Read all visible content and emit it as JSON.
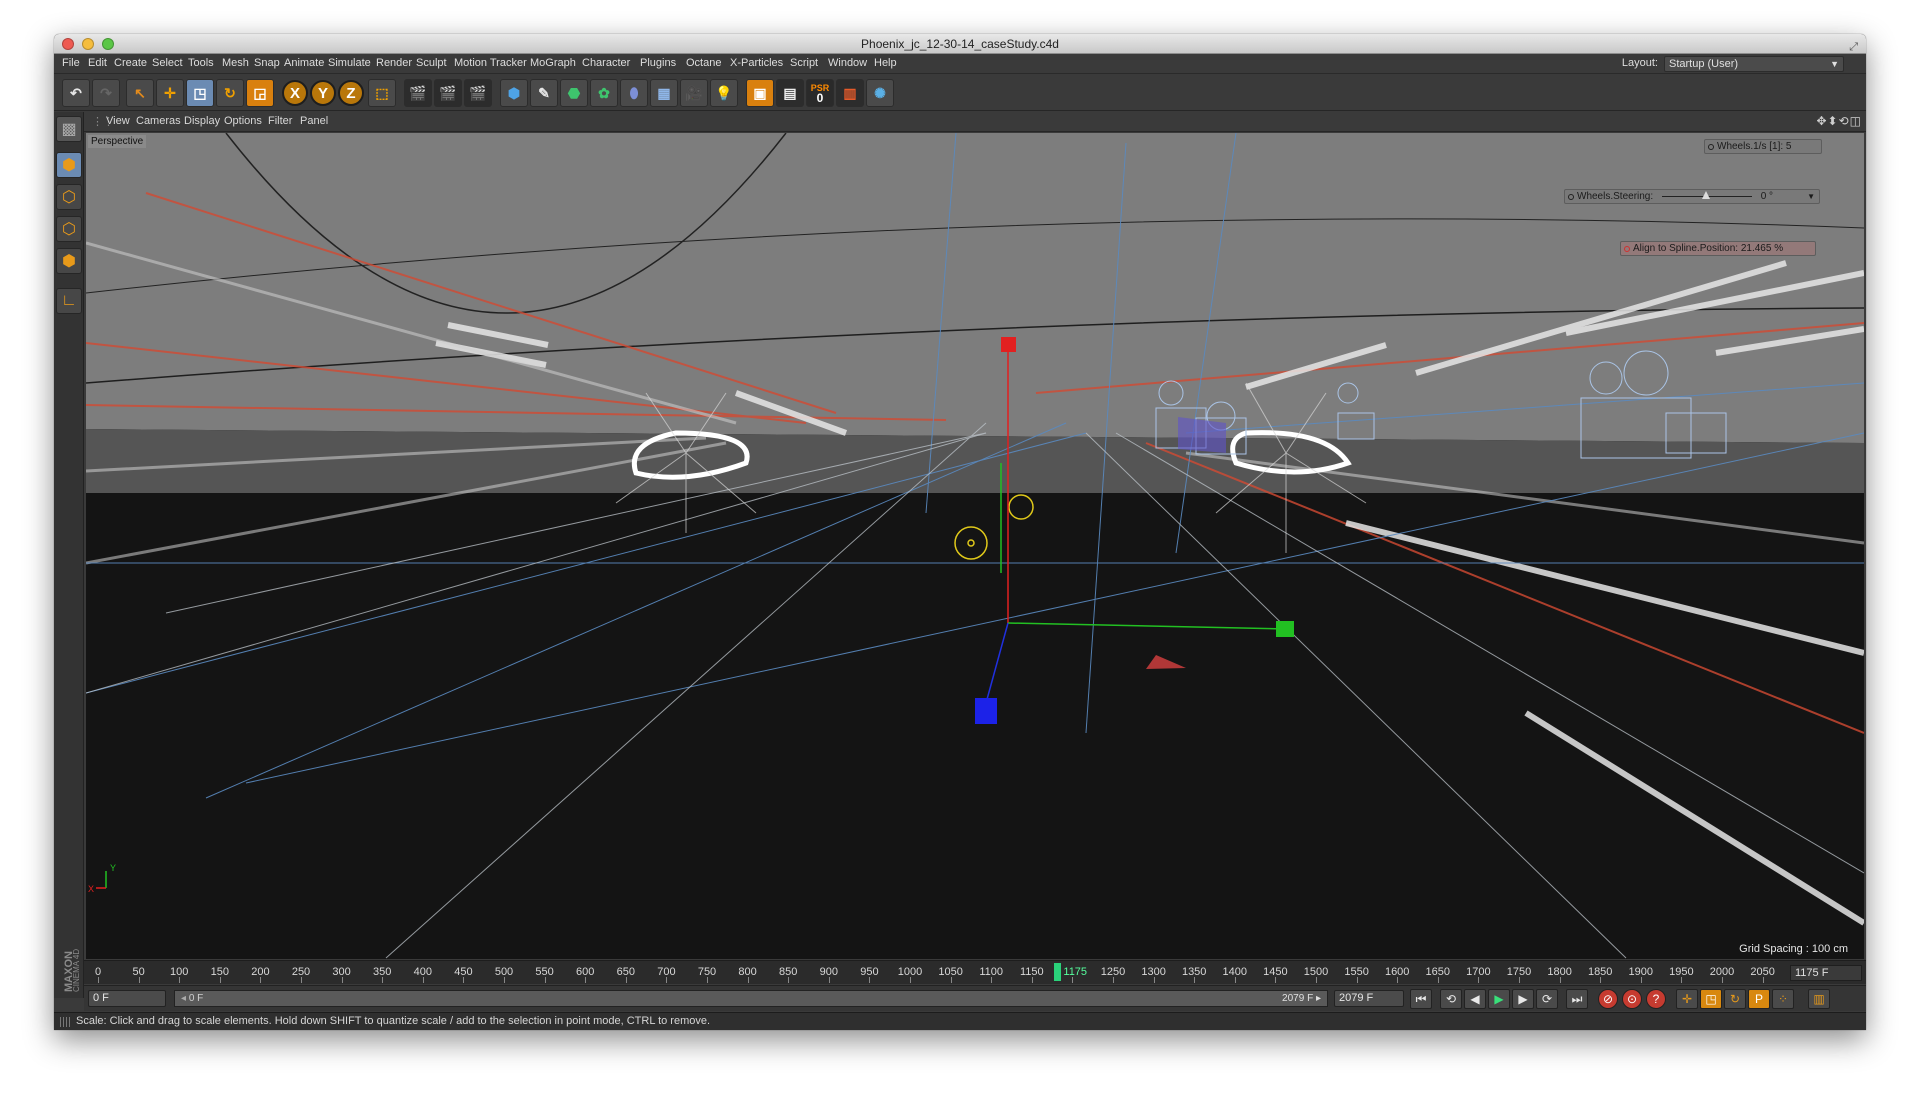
{
  "window": {
    "title": "Phoenix_jc_12-30-14_caseStudy.c4d"
  },
  "menu": [
    "File",
    "Edit",
    "Create",
    "Select",
    "Tools",
    "Mesh",
    "Snap",
    "Animate",
    "Simulate",
    "Render",
    "Sculpt",
    "Motion Tracker",
    "MoGraph",
    "Character",
    "Plugins",
    "Octane",
    "X-Particles",
    "Script",
    "Window",
    "Help"
  ],
  "layout": {
    "label": "Layout:",
    "value": "Startup (User)"
  },
  "toolbar": {
    "axis_x": "X",
    "axis_y": "Y",
    "axis_z": "Z",
    "psr_label": "PSR",
    "psr_value": "0"
  },
  "viewport_menu": [
    "View",
    "Cameras",
    "Display",
    "Options",
    "Filter",
    "Panel"
  ],
  "viewport": {
    "label": "Perspective",
    "grid_spacing": "Grid Spacing : 100 cm",
    "hud": {
      "wheels_1s": "Wheels.1/s [1]:   5",
      "wheels_steering_label": "Wheels.Steering:",
      "wheels_steering_value": "0 °",
      "align_to_spline": "Align to Spline.Position: 21.465 %"
    }
  },
  "timeline": {
    "ticks": [
      "0",
      "50",
      "100",
      "150",
      "200",
      "250",
      "300",
      "350",
      "400",
      "450",
      "500",
      "550",
      "600",
      "650",
      "700",
      "750",
      "800",
      "850",
      "900",
      "950",
      "1000",
      "1050",
      "1100",
      "1150",
      "1175",
      "1250",
      "1300",
      "1350",
      "1400",
      "1450",
      "1500",
      "1550",
      "1600",
      "1650",
      "1700",
      "1750",
      "1800",
      "1850",
      "1900",
      "1950",
      "2000",
      "2050"
    ],
    "current_frame": "1175",
    "end_frame": "1175 F"
  },
  "controls": {
    "start_field": "0 F",
    "range_start": "0 F",
    "range_end": "2079 F",
    "max_field": "2079 F"
  },
  "status": "Scale: Click and drag to scale elements. Hold down SHIFT to quantize scale / add to the selection in point mode, CTRL to remove.",
  "colors": {
    "accent_orange": "#d9800e",
    "playhead_green": "#2ad27a",
    "viewport_bg": "#141414",
    "sky": "#7d7d7d"
  }
}
